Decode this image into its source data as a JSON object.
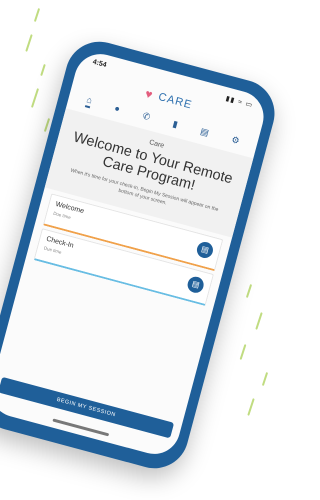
{
  "status": {
    "time": "4:54",
    "icons": "▮▮ ≈ ▭"
  },
  "logo": {
    "mark": "♥",
    "text": "CARE"
  },
  "tabs": [
    {
      "icon": "home-icon",
      "glyph": "⌂"
    },
    {
      "icon": "chat-icon",
      "glyph": "●"
    },
    {
      "icon": "phone-icon",
      "glyph": "✆"
    },
    {
      "icon": "chart-icon",
      "glyph": "▮"
    },
    {
      "icon": "book-icon",
      "glyph": "▤"
    },
    {
      "icon": "settings-icon",
      "glyph": "⚙"
    }
  ],
  "main": {
    "subtitle": "Care",
    "heading": "Welcome to Your Remote Care Program!",
    "instructions": "When it's time for your check-in, Begin My Session will appear on the bottom of your screen."
  },
  "cards": [
    {
      "title": "Welcome",
      "sub": "Due time",
      "accent": "#f0a14a",
      "button_glyph": "▤"
    },
    {
      "title": "Check-In",
      "sub": "Due time",
      "accent": "#68bde3",
      "button_glyph": "▤"
    }
  ],
  "cta": {
    "label": "BEGIN MY SESSION"
  },
  "colors": {
    "brand": "#1f5f99",
    "accent_green": "#b9d873"
  }
}
